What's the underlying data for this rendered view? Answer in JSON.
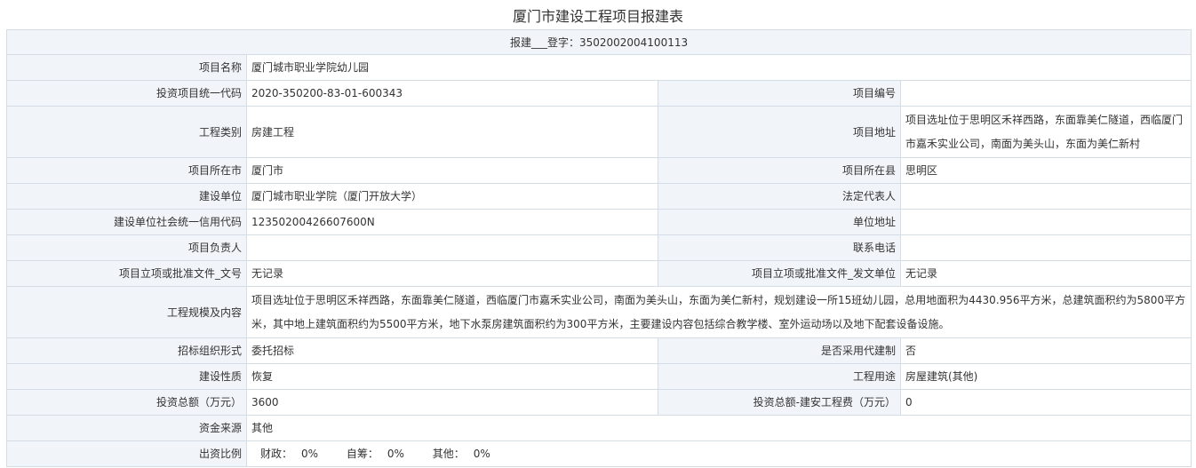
{
  "title": "厦门市建设工程项目报建表",
  "reg_label": "报建___登字：",
  "reg_number": "3502002004100113",
  "fields": {
    "project_name": {
      "label": "项目名称",
      "value": "厦门城市职业学院幼儿园"
    },
    "invest_code": {
      "label": "投资项目统一代码",
      "value": "2020-350200-83-01-600343"
    },
    "project_no": {
      "label": "项目编号",
      "value": ""
    },
    "project_type": {
      "label": "工程类别",
      "value": "房建工程"
    },
    "project_address": {
      "label": "项目地址",
      "value": "项目选址位于思明区禾祥西路，东面靠美仁隧道，西临厦门市嘉禾实业公司，南面为美头山，东面为美仁新村"
    },
    "city": {
      "label": "项目所在市",
      "value": "厦门市"
    },
    "county": {
      "label": "项目所在县",
      "value": "思明区"
    },
    "builder": {
      "label": "建设单位",
      "value": "厦门城市职业学院（厦门开放大学）"
    },
    "legal_rep": {
      "label": "法定代表人",
      "value": ""
    },
    "credit_code": {
      "label": "建设单位社会统一信用代码",
      "value": "12350200426607600N"
    },
    "unit_address": {
      "label": "单位地址",
      "value": ""
    },
    "project_manager": {
      "label": "项目负责人",
      "value": ""
    },
    "contact_phone": {
      "label": "联系电话",
      "value": ""
    },
    "approval_doc_no": {
      "label": "项目立项或批准文件_文号",
      "value": "无记录"
    },
    "approval_unit": {
      "label": "项目立项或批准文件_发文单位",
      "value": "无记录"
    },
    "scale_content": {
      "label": "工程规模及内容",
      "value": "项目选址位于思明区禾祥西路，东面靠美仁隧道，西临厦门市嘉禾实业公司，南面为美头山，东面为美仁新村，规划建设一所15班幼儿园，总用地面积为4430.956平方米，总建筑面积约为5800平方米，其中地上建筑面积约为5500平方米，地下水泵房建筑面积约为300平方米，主要建设内容包括综合教学楼、室外运动场以及地下配套设备设施。"
    },
    "bid_form": {
      "label": "招标组织形式",
      "value": "委托招标"
    },
    "agency_build": {
      "label": "是否采用代建制",
      "value": "否"
    },
    "build_nature": {
      "label": "建设性质",
      "value": "恢复"
    },
    "usage": {
      "label": "工程用途",
      "value": "房屋建筑(其他)"
    },
    "total_invest": {
      "label": "投资总额（万元）",
      "value": "3600"
    },
    "install_cost": {
      "label": "投资总额-建安工程费（万元）",
      "value": "0"
    },
    "fund_source": {
      "label": "资金来源",
      "value": "其他"
    },
    "funding_ratio": {
      "label": "出资比例",
      "items": [
        {
          "label": "财政：",
          "value": "0%"
        },
        {
          "label": "自筹：",
          "value": "0%"
        },
        {
          "label": "其他：",
          "value": "0%"
        }
      ]
    }
  }
}
